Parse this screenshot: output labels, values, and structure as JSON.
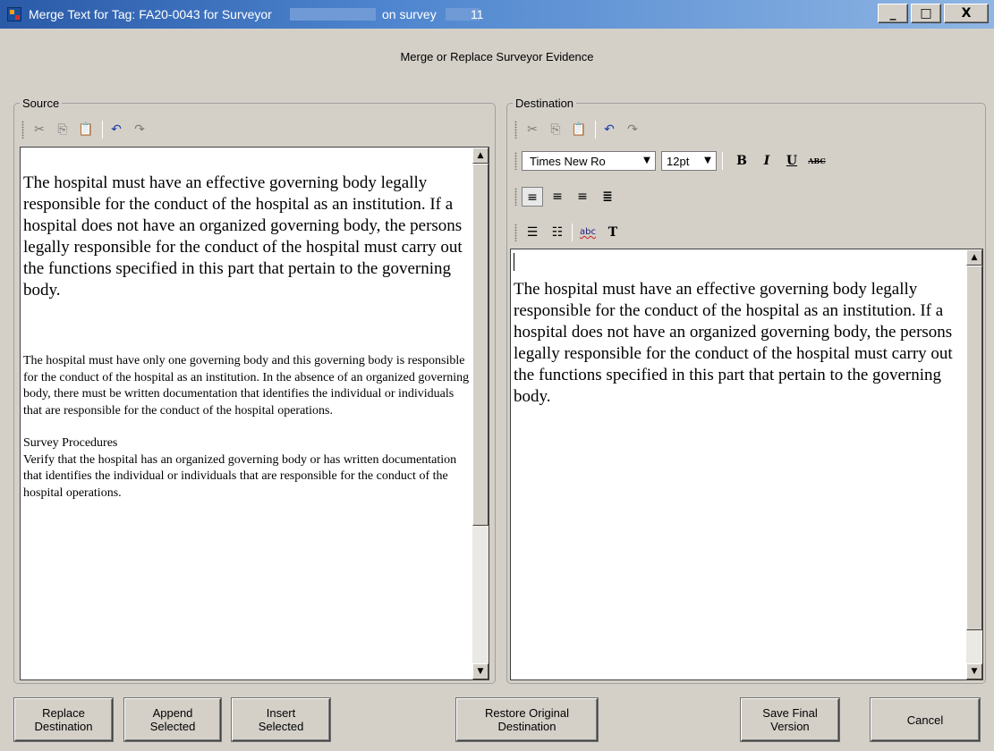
{
  "window": {
    "title_part1": "Merge Text for Tag: FA20-0043 for Surveyor",
    "title_part2": "on survey",
    "title_part3": "11",
    "minimize": "_",
    "maximize": "□",
    "close": "X"
  },
  "heading": "Merge or Replace Surveyor Evidence",
  "source": {
    "label": "Source",
    "paragraph1": "The hospital must have an effective governing body legally responsible for the conduct of the hospital as an institution.  If a hospital does not have an organized governing body, the persons legally responsible for the conduct of the hospital must carry out the functions specified in this part that pertain to the governing body.",
    "paragraph2": "The hospital must have only one governing body and this governing body is responsible for the conduct of the hospital as an institution. In the absence of an organized governing body, there must be written documentation that identifies the individual or individuals that are responsible for the conduct of the hospital operations.",
    "procedures_title": "Survey Procedures",
    "procedures_text": "Verify that the hospital has an organized governing body or has written documentation that identifies the individual or individuals that are responsible for the conduct of the hospital operations."
  },
  "destination": {
    "label": "Destination",
    "font_name": "Times New Ro",
    "font_size": "12pt",
    "paragraph1": "The hospital must have an effective governing body legally responsible for the conduct of the hospital as an institution.  If a hospital does not have an organized governing body, the persons legally responsible for the conduct of the hospital must carry out the functions specified in this part that pertain to the governing body."
  },
  "toolbar_icons": {
    "cut": "scissors-icon",
    "copy": "copy-icon",
    "paste": "paste-icon",
    "undo": "undo-icon",
    "redo": "redo-icon",
    "bold": "B",
    "italic": "I",
    "underline": "U",
    "strikethrough": "ABC",
    "spellcheck": "abc",
    "text_format": "T"
  },
  "buttons": {
    "replace": "Replace\nDestination",
    "append": "Append\nSelected",
    "insert": "Insert\nSelected",
    "restore": "Restore Original\nDestination",
    "save": "Save Final\nVersion",
    "cancel": "Cancel"
  }
}
